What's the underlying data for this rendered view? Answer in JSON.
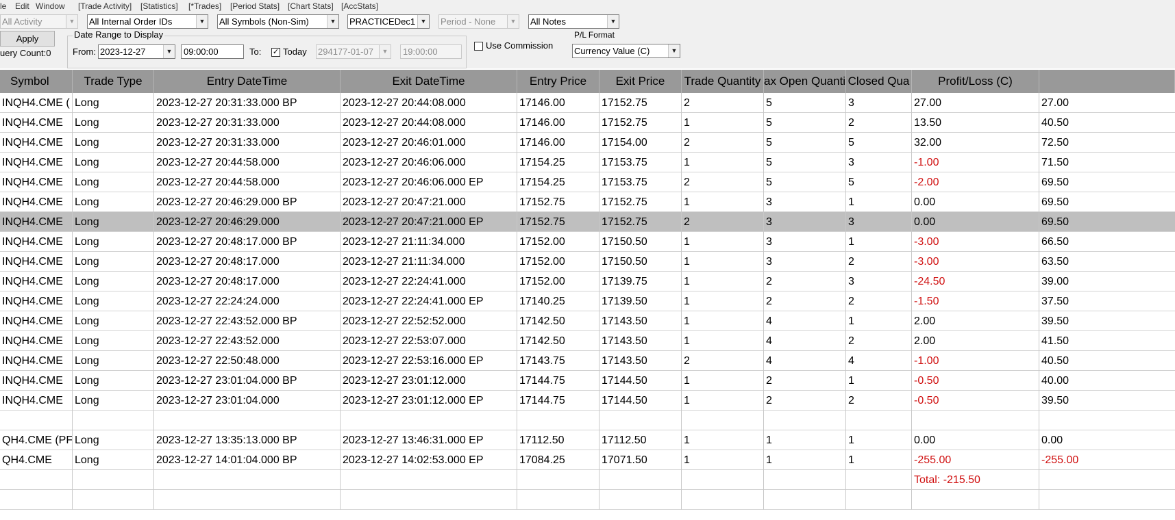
{
  "menu": [
    "le",
    "Edit",
    "Window",
    "[Trade Activity]",
    "[Statistics]",
    "[*Trades]",
    "[Period Stats]",
    "[Chart Stats]",
    "[AccStats]"
  ],
  "filters": {
    "activity": "All Activity",
    "order_ids": "All Internal Order IDs",
    "symbols": "All Symbols (Non-Sim)",
    "account": "PRACTICEDec1",
    "period": "Period - None",
    "notes": "All Notes"
  },
  "apply_label": "Apply",
  "query_count": "uery Count:0",
  "date_range": {
    "title": "Date Range to Display",
    "from_label": "From:",
    "from_date": "2023-12-27",
    "from_time": "09:00:00",
    "to_label": "To:",
    "today_label": "Today",
    "today_checked": "✓",
    "to_date": "294177-01-07",
    "to_time": "19:00:00"
  },
  "use_commission_label": "Use Commission",
  "pl_format": {
    "label": "P/L Format",
    "value": "Currency Value (C)"
  },
  "table": {
    "columns": [
      "Symbol",
      "Trade Type",
      "Entry DateTime",
      "Exit DateTime",
      "Entry Price",
      "Exit Price",
      "Trade Quantity",
      "ax Open Quanti",
      "Closed Qua",
      "Profit/Loss (C)",
      ""
    ],
    "rows": [
      {
        "symbol": "INQH4.CME (",
        "type": "Long",
        "entry": "2023-12-27  20:31:33.000 BP",
        "exit": "2023-12-27  20:44:08.000",
        "entry_price": "17146.00",
        "exit_price": "17152.75",
        "qty": "2",
        "max_open": "5",
        "closed": "3",
        "pl": "27.00",
        "cum": "27.00",
        "pl_neg": false,
        "cum_neg": false
      },
      {
        "symbol": "INQH4.CME",
        "type": "Long",
        "entry": "2023-12-27  20:31:33.000",
        "exit": "2023-12-27  20:44:08.000",
        "entry_price": "17146.00",
        "exit_price": "17152.75",
        "qty": "1",
        "max_open": "5",
        "closed": "2",
        "pl": "13.50",
        "cum": "40.50",
        "pl_neg": false,
        "cum_neg": false
      },
      {
        "symbol": "INQH4.CME",
        "type": "Long",
        "entry": "2023-12-27  20:31:33.000",
        "exit": "2023-12-27  20:46:01.000",
        "entry_price": "17146.00",
        "exit_price": "17154.00",
        "qty": "2",
        "max_open": "5",
        "closed": "5",
        "pl": "32.00",
        "cum": "72.50",
        "pl_neg": false,
        "cum_neg": false
      },
      {
        "symbol": "INQH4.CME",
        "type": "Long",
        "entry": "2023-12-27  20:44:58.000",
        "exit": "2023-12-27  20:46:06.000",
        "entry_price": "17154.25",
        "exit_price": "17153.75",
        "qty": "1",
        "max_open": "5",
        "closed": "3",
        "pl": "-1.00",
        "cum": "71.50",
        "pl_neg": true,
        "cum_neg": false
      },
      {
        "symbol": "INQH4.CME",
        "type": "Long",
        "entry": "2023-12-27  20:44:58.000",
        "exit": "2023-12-27  20:46:06.000 EP",
        "entry_price": "17154.25",
        "exit_price": "17153.75",
        "qty": "2",
        "max_open": "5",
        "closed": "5",
        "pl": "-2.00",
        "cum": "69.50",
        "pl_neg": true,
        "cum_neg": false
      },
      {
        "symbol": "INQH4.CME",
        "type": "Long",
        "entry": "2023-12-27  20:46:29.000 BP",
        "exit": "2023-12-27  20:47:21.000",
        "entry_price": "17152.75",
        "exit_price": "17152.75",
        "qty": "1",
        "max_open": "3",
        "closed": "1",
        "pl": "0.00",
        "cum": "69.50",
        "pl_neg": false,
        "cum_neg": false
      },
      {
        "symbol": "INQH4.CME",
        "type": "Long",
        "entry": "2023-12-27  20:46:29.000",
        "exit": "2023-12-27  20:47:21.000 EP",
        "entry_price": "17152.75",
        "exit_price": "17152.75",
        "qty": "2",
        "max_open": "3",
        "closed": "3",
        "pl": "0.00",
        "cum": "69.50",
        "pl_neg": false,
        "cum_neg": false,
        "selected": true
      },
      {
        "symbol": "INQH4.CME",
        "type": "Long",
        "entry": "2023-12-27  20:48:17.000 BP",
        "exit": "2023-12-27  21:11:34.000",
        "entry_price": "17152.00",
        "exit_price": "17150.50",
        "qty": "1",
        "max_open": "3",
        "closed": "1",
        "pl": "-3.00",
        "cum": "66.50",
        "pl_neg": true,
        "cum_neg": false
      },
      {
        "symbol": "INQH4.CME",
        "type": "Long",
        "entry": "2023-12-27  20:48:17.000",
        "exit": "2023-12-27  21:11:34.000",
        "entry_price": "17152.00",
        "exit_price": "17150.50",
        "qty": "1",
        "max_open": "3",
        "closed": "2",
        "pl": "-3.00",
        "cum": "63.50",
        "pl_neg": true,
        "cum_neg": false
      },
      {
        "symbol": "INQH4.CME",
        "type": "Long",
        "entry": "2023-12-27  20:48:17.000",
        "exit": "2023-12-27  22:24:41.000",
        "entry_price": "17152.00",
        "exit_price": "17139.75",
        "qty": "1",
        "max_open": "2",
        "closed": "3",
        "pl": "-24.50",
        "cum": "39.00",
        "pl_neg": true,
        "cum_neg": false
      },
      {
        "symbol": "INQH4.CME",
        "type": "Long",
        "entry": "2023-12-27  22:24:24.000",
        "exit": "2023-12-27  22:24:41.000 EP",
        "entry_price": "17140.25",
        "exit_price": "17139.50",
        "qty": "1",
        "max_open": "2",
        "closed": "2",
        "pl": "-1.50",
        "cum": "37.50",
        "pl_neg": true,
        "cum_neg": false
      },
      {
        "symbol": "INQH4.CME",
        "type": "Long",
        "entry": "2023-12-27  22:43:52.000 BP",
        "exit": "2023-12-27  22:52:52.000",
        "entry_price": "17142.50",
        "exit_price": "17143.50",
        "qty": "1",
        "max_open": "4",
        "closed": "1",
        "pl": "2.00",
        "cum": "39.50",
        "pl_neg": false,
        "cum_neg": false
      },
      {
        "symbol": "INQH4.CME",
        "type": "Long",
        "entry": "2023-12-27  22:43:52.000",
        "exit": "2023-12-27  22:53:07.000",
        "entry_price": "17142.50",
        "exit_price": "17143.50",
        "qty": "1",
        "max_open": "4",
        "closed": "2",
        "pl": "2.00",
        "cum": "41.50",
        "pl_neg": false,
        "cum_neg": false
      },
      {
        "symbol": "INQH4.CME",
        "type": "Long",
        "entry": "2023-12-27  22:50:48.000",
        "exit": "2023-12-27  22:53:16.000 EP",
        "entry_price": "17143.75",
        "exit_price": "17143.50",
        "qty": "2",
        "max_open": "4",
        "closed": "4",
        "pl": "-1.00",
        "cum": "40.50",
        "pl_neg": true,
        "cum_neg": false
      },
      {
        "symbol": "INQH4.CME",
        "type": "Long",
        "entry": "2023-12-27  23:01:04.000 BP",
        "exit": "2023-12-27  23:01:12.000",
        "entry_price": "17144.75",
        "exit_price": "17144.50",
        "qty": "1",
        "max_open": "2",
        "closed": "1",
        "pl": "-0.50",
        "cum": "40.00",
        "pl_neg": true,
        "cum_neg": false
      },
      {
        "symbol": "INQH4.CME",
        "type": "Long",
        "entry": "2023-12-27  23:01:04.000",
        "exit": "2023-12-27  23:01:12.000 EP",
        "entry_price": "17144.75",
        "exit_price": "17144.50",
        "qty": "1",
        "max_open": "2",
        "closed": "2",
        "pl": "-0.50",
        "cum": "39.50",
        "pl_neg": true,
        "cum_neg": false
      },
      {
        "symbol": "",
        "type": "",
        "entry": "",
        "exit": "",
        "entry_price": "",
        "exit_price": "",
        "qty": "",
        "max_open": "",
        "closed": "",
        "pl": "",
        "cum": "",
        "pl_neg": false,
        "cum_neg": false
      },
      {
        "symbol": "QH4.CME (PF",
        "type": "Long",
        "entry": "2023-12-27  13:35:13.000 BP",
        "exit": "2023-12-27  13:46:31.000 EP",
        "entry_price": "17112.50",
        "exit_price": "17112.50",
        "qty": "1",
        "max_open": "1",
        "closed": "1",
        "pl": "0.00",
        "cum": "0.00",
        "pl_neg": false,
        "cum_neg": false
      },
      {
        "symbol": "QH4.CME",
        "type": "Long",
        "entry": "2023-12-27  14:01:04.000 BP",
        "exit": "2023-12-27  14:02:53.000 EP",
        "entry_price": "17084.25",
        "exit_price": "17071.50",
        "qty": "1",
        "max_open": "1",
        "closed": "1",
        "pl": "-255.00",
        "cum": "-255.00",
        "pl_neg": true,
        "cum_neg": true
      },
      {
        "symbol": "",
        "type": "",
        "entry": "",
        "exit": "",
        "entry_price": "",
        "exit_price": "",
        "qty": "",
        "max_open": "",
        "closed": "",
        "pl": "Total: -215.50",
        "cum": "",
        "pl_neg": true,
        "cum_neg": false
      },
      {
        "symbol": "",
        "type": "",
        "entry": "",
        "exit": "",
        "entry_price": "",
        "exit_price": "",
        "qty": "",
        "max_open": "",
        "closed": "",
        "pl": "",
        "cum": "",
        "pl_neg": false,
        "cum_neg": false
      }
    ]
  },
  "colors": {
    "header_bg": "#999999",
    "selected_row": "#bfbfbf",
    "negative": "#d01010",
    "toolbar_bg": "#f0f0f0"
  }
}
